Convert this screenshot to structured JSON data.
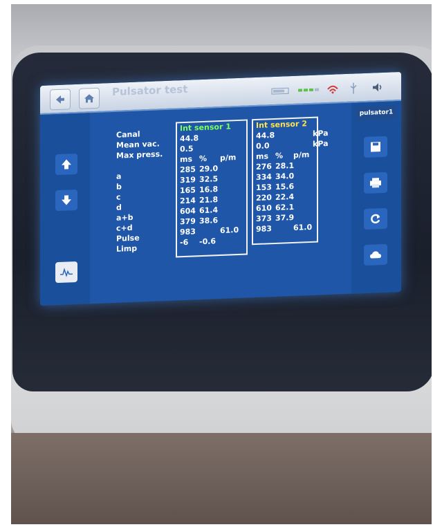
{
  "header": {
    "title": "Pulsator test",
    "subtitle": "",
    "back_icon": "back-arrow-icon",
    "home_icon": "home-icon"
  },
  "status_icons": [
    "battery-icon",
    "signal-icon",
    "wifi-icon",
    "usb-icon",
    "speaker-icon"
  ],
  "right_panel": {
    "label": "pulsator1",
    "buttons": [
      "save-icon",
      "print-icon",
      "refresh-icon",
      "cloud-icon"
    ]
  },
  "left_panel": {
    "buttons": [
      "arrow-up-icon",
      "arrow-down-icon",
      "graph-icon"
    ]
  },
  "row_labels": [
    "Canal",
    "Mean vac.",
    "Max press.",
    "",
    "a",
    "b",
    "c",
    "d",
    "a+b",
    "c+d",
    "Pulse",
    "Limp"
  ],
  "sensor1": {
    "header": "Int sensor 1",
    "mean_vac": "44.8",
    "max_press": "0.5",
    "cols": [
      "ms",
      "%",
      "p/m"
    ],
    "rows": [
      [
        "285",
        "29.0",
        ""
      ],
      [
        "319",
        "32.5",
        ""
      ],
      [
        "165",
        "16.8",
        ""
      ],
      [
        "214",
        "21.8",
        ""
      ],
      [
        "604",
        "61.4",
        ""
      ],
      [
        "379",
        "38.6",
        ""
      ],
      [
        "983",
        "",
        "61.0"
      ],
      [
        "-6",
        "-0.6",
        ""
      ]
    ]
  },
  "sensor2": {
    "header": "Int sensor 2",
    "mean_vac": "44.8",
    "max_press": "0.0",
    "cols": [
      "ms",
      "%",
      "p/m"
    ],
    "rows": [
      [
        "276",
        "28.1",
        ""
      ],
      [
        "334",
        "34.0",
        ""
      ],
      [
        "153",
        "15.6",
        ""
      ],
      [
        "220",
        "22.4",
        ""
      ],
      [
        "610",
        "62.1",
        ""
      ],
      [
        "373",
        "37.9",
        ""
      ],
      [
        "983",
        "",
        "61.0"
      ]
    ]
  },
  "units": [
    "kPa",
    "kPa"
  ],
  "colors": {
    "screen_bg": "#1f56a8",
    "sensor1_header": "#7dff5a",
    "sensor2_header": "#ffe34a"
  }
}
